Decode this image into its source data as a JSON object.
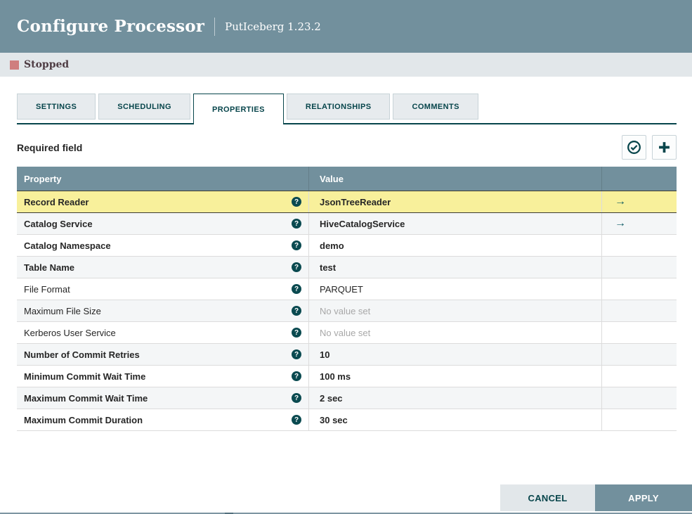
{
  "header": {
    "title": "Configure Processor",
    "subtitle": "PutIceberg 1.23.2"
  },
  "status": {
    "label": "Stopped"
  },
  "tabs": [
    {
      "label": "SETTINGS",
      "active": false
    },
    {
      "label": "SCHEDULING",
      "active": false
    },
    {
      "label": "PROPERTIES",
      "active": true
    },
    {
      "label": "RELATIONSHIPS",
      "active": false
    },
    {
      "label": "COMMENTS",
      "active": false
    }
  ],
  "toolbar": {
    "required_label": "Required field",
    "verify_icon": "check-circle-icon",
    "add_icon": "plus-icon"
  },
  "table": {
    "columns": [
      "Property",
      "Value"
    ],
    "rows": [
      {
        "property": "Record Reader",
        "required": true,
        "value": "JsonTreeReader",
        "has_link": true,
        "unset": false,
        "selected": true
      },
      {
        "property": "Catalog Service",
        "required": true,
        "value": "HiveCatalogService",
        "has_link": true,
        "unset": false,
        "selected": false
      },
      {
        "property": "Catalog Namespace",
        "required": true,
        "value": "demo",
        "has_link": false,
        "unset": false,
        "selected": false
      },
      {
        "property": "Table Name",
        "required": true,
        "value": "test",
        "has_link": false,
        "unset": false,
        "selected": false
      },
      {
        "property": "File Format",
        "required": false,
        "value": "PARQUET",
        "has_link": false,
        "unset": false,
        "selected": false
      },
      {
        "property": "Maximum File Size",
        "required": false,
        "value": "No value set",
        "has_link": false,
        "unset": true,
        "selected": false
      },
      {
        "property": "Kerberos User Service",
        "required": false,
        "value": "No value set",
        "has_link": false,
        "unset": true,
        "selected": false
      },
      {
        "property": "Number of Commit Retries",
        "required": true,
        "value": "10",
        "has_link": false,
        "unset": false,
        "selected": false
      },
      {
        "property": "Minimum Commit Wait Time",
        "required": true,
        "value": "100 ms",
        "has_link": false,
        "unset": false,
        "selected": false
      },
      {
        "property": "Maximum Commit Wait Time",
        "required": true,
        "value": "2 sec",
        "has_link": false,
        "unset": false,
        "selected": false
      },
      {
        "property": "Maximum Commit Duration",
        "required": true,
        "value": "30 sec",
        "has_link": false,
        "unset": false,
        "selected": false
      }
    ],
    "help_glyph": "?",
    "goto_glyph": "→"
  },
  "footer": {
    "cancel_label": "CANCEL",
    "apply_label": "APPLY"
  },
  "colors": {
    "header_bg": "#72909D",
    "status_bar_bg": "#E2E7EA",
    "accent_teal": "#07454B",
    "stopped_square": "#CF7E7E",
    "stopped_text": "#4E3C43",
    "selected_row_bg": "#F8F09B",
    "alt_row_bg": "#F4F6F7",
    "unset_text": "#A8A8A8",
    "arrow_color": "#0A5961"
  }
}
